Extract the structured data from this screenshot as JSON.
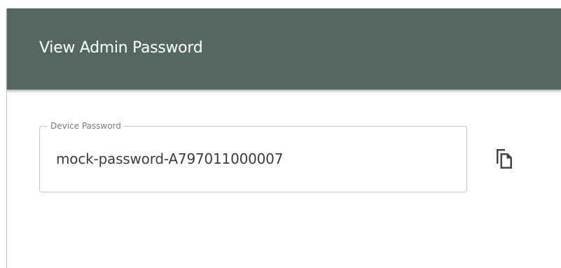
{
  "dialog": {
    "title": "View Admin Password"
  },
  "password_field": {
    "label": "Device Password",
    "value": "mock-password-A797011000007"
  },
  "copy_button": {
    "icon": "copy-icon"
  },
  "colors": {
    "header_background": "#546763",
    "header_text": "#ffffff",
    "field_border": "#c7c7c7",
    "field_label": "#7a7a7a",
    "field_text": "#3c3c3c",
    "icon": "#444444"
  }
}
